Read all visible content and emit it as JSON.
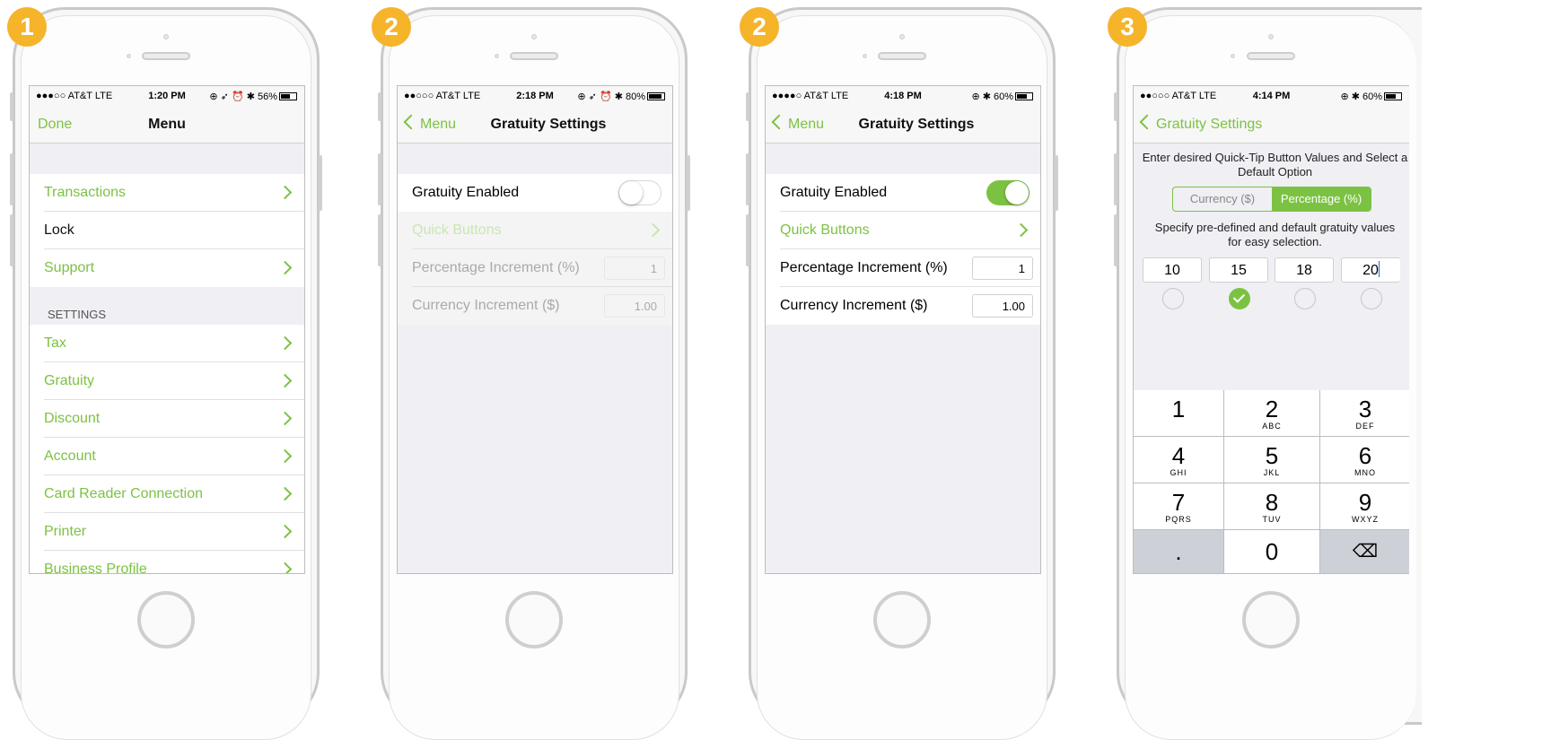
{
  "phones": [
    {
      "badge": "1",
      "status": {
        "left": "●●●○○ AT&T  LTE",
        "time": "1:20 PM",
        "right": "⊕ ➶ ⏰ ✱ 56%"
      },
      "nav": {
        "left": "Done",
        "title": "Menu"
      },
      "rows": [
        {
          "label": "Transactions",
          "color": "#7cc242"
        },
        {
          "label": "Lock",
          "color": "#111111"
        },
        {
          "label": "Support",
          "color": "#7cc242"
        }
      ],
      "section": "SETTINGS",
      "settings_rows": [
        "Tax",
        "Gratuity",
        "Discount",
        "Account",
        "Card Reader Connection",
        "Printer",
        "Business Profile"
      ]
    },
    {
      "badge": "2",
      "status": {
        "left": "●●○○○ AT&T  LTE",
        "time": "2:18 PM",
        "right": "⊕ ➶ ⏰ ✱ 80%"
      },
      "nav": {
        "back": "Menu",
        "title": "Gratuity Settings"
      },
      "gratuity_enabled_label": "Gratuity Enabled",
      "toggle_on": false,
      "quick_buttons": "Quick Buttons",
      "percentage_label": "Percentage Increment (%)",
      "percentage_value": "1",
      "currency_label": "Currency Increment ($)",
      "currency_value": "1.00"
    },
    {
      "badge": "2",
      "status": {
        "left": "●●●●○ AT&T  LTE",
        "time": "4:18 PM",
        "right": "⊕ ✱ 60%"
      },
      "nav": {
        "back": "Menu",
        "title": "Gratuity Settings"
      },
      "gratuity_enabled_label": "Gratuity Enabled",
      "toggle_on": true,
      "quick_buttons": "Quick Buttons",
      "percentage_label": "Percentage Increment (%)",
      "percentage_value": "1",
      "currency_label": "Currency Increment ($)",
      "currency_value": "1.00"
    },
    {
      "badge": "3",
      "status": {
        "left": "●●○○○ AT&T  LTE",
        "time": "4:14 PM",
        "right": "⊕ ✱ 60%"
      },
      "nav": {
        "back": "Gratuity Settings"
      },
      "instruction1": "Enter desired Quick-Tip Button Values and Select a Default Option",
      "seg_currency": "Currency ($)",
      "seg_percentage": "Percentage (%)",
      "instruction2": "Specify pre-defined and default gratuity values for easy selection.",
      "tips": [
        "10",
        "15",
        "18",
        "20"
      ],
      "default_index": 1,
      "keys": [
        {
          "digit": "1",
          "sub": ""
        },
        {
          "digit": "2",
          "sub": "ABC"
        },
        {
          "digit": "3",
          "sub": "DEF"
        },
        {
          "digit": "4",
          "sub": "GHI"
        },
        {
          "digit": "5",
          "sub": "JKL"
        },
        {
          "digit": "6",
          "sub": "MNO"
        },
        {
          "digit": "7",
          "sub": "PQRS"
        },
        {
          "digit": "8",
          "sub": "TUV"
        },
        {
          "digit": "9",
          "sub": "WXYZ"
        },
        {
          "digit": ".",
          "sub": ""
        },
        {
          "digit": "0",
          "sub": ""
        },
        {
          "digit": "⌫",
          "sub": ""
        }
      ]
    }
  ],
  "colors": {
    "accent": "#7cc242",
    "badge": "#f5b42a"
  }
}
